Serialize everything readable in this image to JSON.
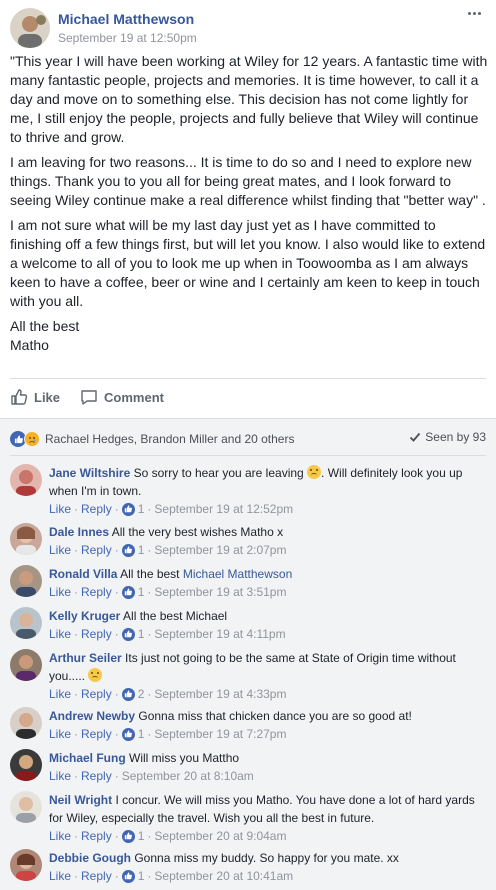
{
  "post": {
    "author": "Michael Matthewson",
    "timestamp": "September 19 at 12:50pm",
    "paragraphs": [
      "\"This year I will have been working at Wiley for 12 years. A fantastic time with many fantastic people, projects and memories. It is time however, to call it a day and move on to something else. This decision has not come lightly for me, I still enjoy the people, projects and fully believe that Wiley will continue to thrive and grow.",
      "I am leaving for two reasons... It is time to do so and I need to explore new things. Thank you to you all for being great mates, and I look forward to seeing Wiley continue make a real difference whilst finding that \"better way\" .",
      "I am not sure what will be my last day just yet as I have committed to finishing off a few things first, but will let you know. I also would like to extend a welcome to all of you to look me up when in Toowoomba as I am always keen to have a coffee, beer or wine and I certainly am keen to keep in touch with you all.",
      "All the best\nMatho"
    ],
    "actions": {
      "like": "Like",
      "comment": "Comment"
    }
  },
  "reactions": {
    "names": "Rachael Hedges, Brandon Miller and 20 others",
    "seen": "Seen by 93"
  },
  "comment_labels": {
    "like": "Like",
    "reply": "Reply"
  },
  "comments": [
    {
      "name": "Jane Wiltshire",
      "text": "So sorry to hear you are leaving",
      "text2": ". Will definitely look you up when I'm in town.",
      "likes": "1",
      "time": "September 19 at 12:52pm",
      "avatar_color": "#c9756a"
    },
    {
      "name": "Dale Innes",
      "text": "All the very best wishes Matho x",
      "likes": "1",
      "time": "September 19 at 2:07pm",
      "avatar_color": "#8a5a44"
    },
    {
      "name": "Ronald Villa",
      "text": "All the best",
      "mention": "Michael Matthewson",
      "likes": "1",
      "time": "September 19 at 3:51pm",
      "avatar_color": "#6b4f3a"
    },
    {
      "name": "Kelly Kruger",
      "text": "All the best Michael",
      "likes": "1",
      "time": "September 19 at 4:11pm",
      "avatar_color": "#7d8c9a"
    },
    {
      "name": "Arthur Seiler",
      "text": "Its just not going to be the same at State of Origin time without you.....",
      "likes": "2",
      "time": "September 19 at 4:33pm",
      "avatar_color": "#5c4a3c"
    },
    {
      "name": "Andrew Newby",
      "text": "Gonna miss that chicken dance you are so good at!",
      "likes": "1",
      "time": "September 19 at 7:27pm",
      "avatar_color": "#a08a78"
    },
    {
      "name": "Michael Fung",
      "text": "Will miss you Mattho",
      "likes": "",
      "time": "September 20 at 8:10am",
      "avatar_color": "#2a2a2a"
    },
    {
      "name": "Neil Wright",
      "text": "I concur. We will miss you Matho. You have done a lot of hard yards for Wiley, especially the travel. Wish you all the best in future.",
      "likes": "1",
      "time": "September 20 at 9:04am",
      "avatar_color": "#b89a84"
    },
    {
      "name": "Debbie Gough",
      "text": "Gonna miss my buddy. So happy for you mate. xx",
      "likes": "1",
      "time": "September 20 at 10:41am",
      "avatar_color": "#9a6a58"
    }
  ]
}
